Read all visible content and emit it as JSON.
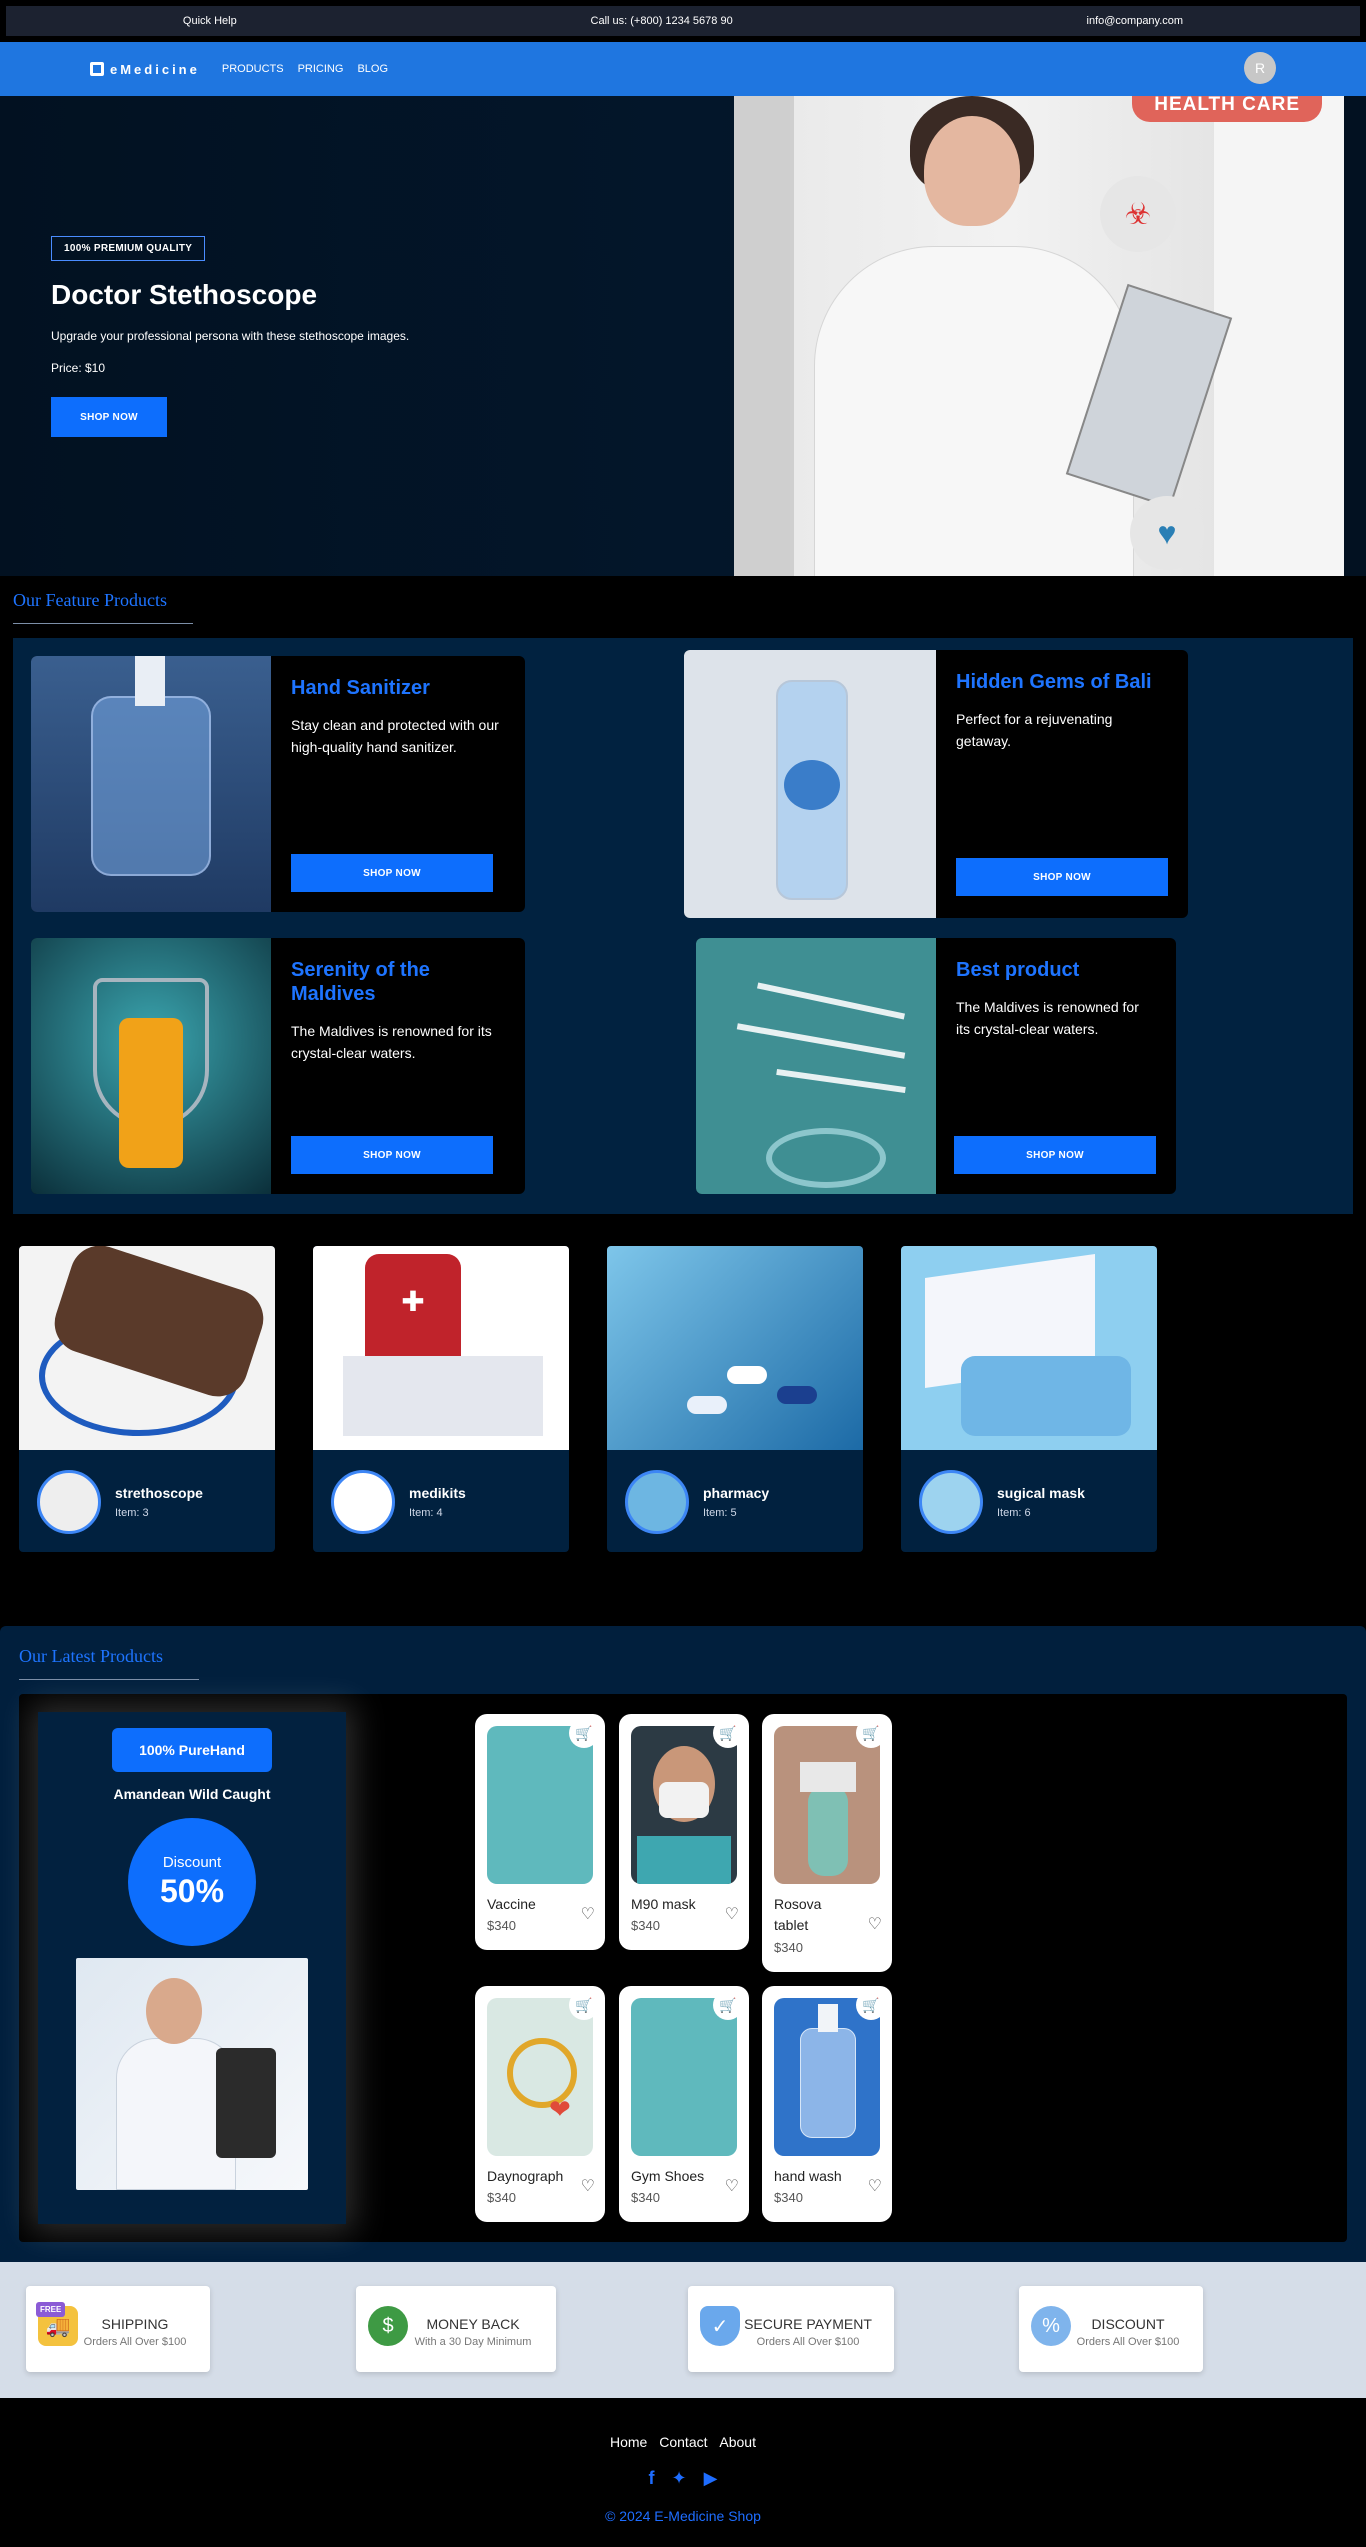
{
  "topbar": {
    "quick_help": "Quick Help",
    "call": "Call us: (+800) 1234 5678 90",
    "email": "info@company.com"
  },
  "navbar": {
    "logo": "eMedicine",
    "links": [
      "PRODUCTS",
      "PRICING",
      "BLOG"
    ],
    "avatar_initial": "R"
  },
  "hero": {
    "badge": "100% PREMIUM QUALITY",
    "title": "Doctor Stethoscope",
    "subtitle": "Upgrade your professional persona with these stethoscope images.",
    "price": "Price: $10",
    "button": "SHOP NOW",
    "image_label": "HEALTH CARE"
  },
  "featured": {
    "section_title": "Our Feature Products",
    "cards": [
      {
        "title": "Hand Sanitizer",
        "description": "Stay clean and protected with our high-quality hand sanitizer.",
        "button": "SHOP NOW"
      },
      {
        "title": "Hidden Gems of Bali",
        "description": "Perfect for a rejuvenating getaway.",
        "button": "SHOP NOW"
      },
      {
        "title": "Serenity of the Maldives",
        "description": "The Maldives is renowned for its crystal-clear waters.",
        "button": "SHOP NOW"
      },
      {
        "title": "Best product",
        "description": "The Maldives is renowned for its crystal-clear waters.",
        "button": "SHOP NOW"
      }
    ]
  },
  "categories": [
    {
      "name": "strethoscope",
      "count": "Item: 3"
    },
    {
      "name": "medikits",
      "count": "Item: 4"
    },
    {
      "name": "pharmacy",
      "count": "Item: 5"
    },
    {
      "name": "sugical mask",
      "count": "Item: 6"
    }
  ],
  "latest": {
    "section_title": "Our Latest Products",
    "promo": {
      "badge": "100% PureHand",
      "name": "Amandean Wild Caught",
      "discount_label": "Discount",
      "discount_value": "50%"
    },
    "products": [
      {
        "name": "Vaccine",
        "price": "$340"
      },
      {
        "name": "M90 mask",
        "price": "$340"
      },
      {
        "name": "Rosova tablet",
        "price": "$340"
      },
      {
        "name": "Daynograph",
        "price": "$340"
      },
      {
        "name": "Gym Shoes",
        "price": "$340"
      },
      {
        "name": "hand wash",
        "price": "$340"
      }
    ]
  },
  "features": [
    {
      "icon": "truck-icon",
      "badge": "FREE",
      "title": "SHIPPING",
      "subtitle": "Orders All Over $100"
    },
    {
      "icon": "money-bag-icon",
      "title": "MONEY BACK",
      "subtitle": "With a 30 Day Minimum"
    },
    {
      "icon": "shield-check-icon",
      "title": "SECURE PAYMENT",
      "subtitle": "Orders All Over $100"
    },
    {
      "icon": "percent-badge-icon",
      "title": "DISCOUNT",
      "subtitle": "Orders All Over $100"
    }
  ],
  "footer": {
    "links": [
      "Home",
      "Contact",
      "About"
    ],
    "social": [
      "facebook-icon",
      "twitter-icon",
      "youtube-icon"
    ],
    "copyright": "© 2024 E-Medicine Shop"
  },
  "colors": {
    "accent": "#0d6efd",
    "navbar": "#1f76e0",
    "panel": "#012240",
    "health_care_label": "#e0645a"
  }
}
